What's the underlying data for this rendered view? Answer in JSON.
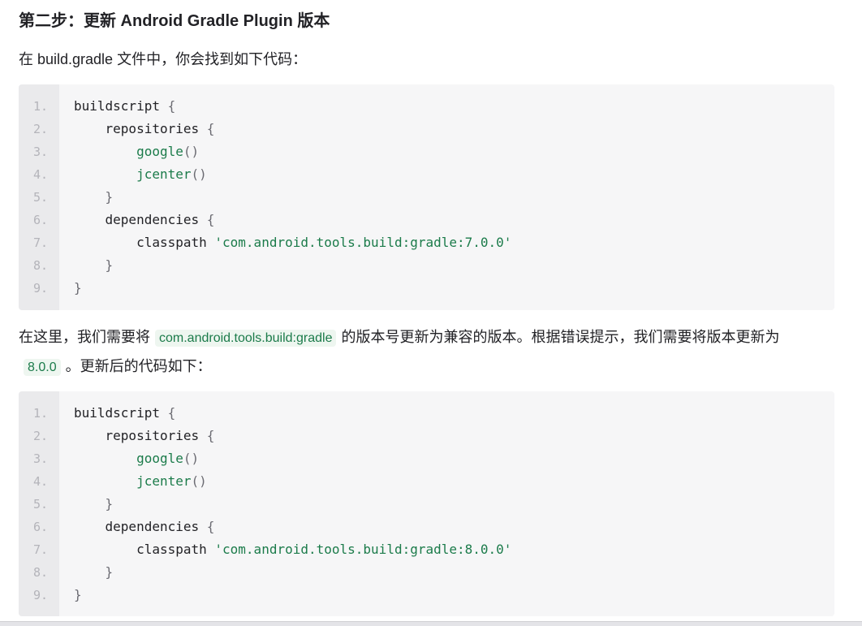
{
  "heading": "第二步：更新 Android Gradle Plugin 版本",
  "para1": "在 build.gradle 文件中，你会找到如下代码：",
  "para2": {
    "part1": "在这里，我们需要将",
    "code1": "com.android.tools.build:gradle",
    "part2": "的版本号更新为兼容的版本。根据错误提示，我们需要将版本更新为",
    "code2": "8.0.0",
    "part3": "。更新后的代码如下："
  },
  "code_blocks": [
    {
      "lines": [
        {
          "num": "1.",
          "indent": "",
          "parts": [
            {
              "t": "buildscript ",
              "c": ""
            },
            {
              "t": "{",
              "c": "pun"
            }
          ]
        },
        {
          "num": "2.",
          "indent": "    ",
          "parts": [
            {
              "t": "repositories ",
              "c": ""
            },
            {
              "t": "{",
              "c": "pun"
            }
          ]
        },
        {
          "num": "3.",
          "indent": "        ",
          "parts": [
            {
              "t": "google",
              "c": "fn"
            },
            {
              "t": "()",
              "c": "pun"
            }
          ]
        },
        {
          "num": "4.",
          "indent": "        ",
          "parts": [
            {
              "t": "jcenter",
              "c": "fn"
            },
            {
              "t": "()",
              "c": "pun"
            }
          ]
        },
        {
          "num": "5.",
          "indent": "    ",
          "parts": [
            {
              "t": "}",
              "c": "pun"
            }
          ]
        },
        {
          "num": "6.",
          "indent": "    ",
          "parts": [
            {
              "t": "dependencies ",
              "c": ""
            },
            {
              "t": "{",
              "c": "pun"
            }
          ]
        },
        {
          "num": "7.",
          "indent": "        ",
          "parts": [
            {
              "t": "classpath ",
              "c": ""
            },
            {
              "t": "'com.android.tools.build:gradle:7.0.0'",
              "c": "str"
            }
          ]
        },
        {
          "num": "8.",
          "indent": "    ",
          "parts": [
            {
              "t": "}",
              "c": "pun"
            }
          ]
        },
        {
          "num": "9.",
          "indent": "",
          "parts": [
            {
              "t": "}",
              "c": "pun"
            }
          ]
        }
      ]
    },
    {
      "lines": [
        {
          "num": "1.",
          "indent": "",
          "parts": [
            {
              "t": "buildscript ",
              "c": ""
            },
            {
              "t": "{",
              "c": "pun"
            }
          ]
        },
        {
          "num": "2.",
          "indent": "    ",
          "parts": [
            {
              "t": "repositories ",
              "c": ""
            },
            {
              "t": "{",
              "c": "pun"
            }
          ]
        },
        {
          "num": "3.",
          "indent": "        ",
          "parts": [
            {
              "t": "google",
              "c": "fn"
            },
            {
              "t": "()",
              "c": "pun"
            }
          ]
        },
        {
          "num": "4.",
          "indent": "        ",
          "parts": [
            {
              "t": "jcenter",
              "c": "fn"
            },
            {
              "t": "()",
              "c": "pun"
            }
          ]
        },
        {
          "num": "5.",
          "indent": "    ",
          "parts": [
            {
              "t": "}",
              "c": "pun"
            }
          ]
        },
        {
          "num": "6.",
          "indent": "    ",
          "parts": [
            {
              "t": "dependencies ",
              "c": ""
            },
            {
              "t": "{",
              "c": "pun"
            }
          ]
        },
        {
          "num": "7.",
          "indent": "        ",
          "parts": [
            {
              "t": "classpath ",
              "c": ""
            },
            {
              "t": "'com.android.tools.build:gradle:8.0.0'",
              "c": "str"
            }
          ]
        },
        {
          "num": "8.",
          "indent": "    ",
          "parts": [
            {
              "t": "}",
              "c": "pun"
            }
          ]
        },
        {
          "num": "9.",
          "indent": "",
          "parts": [
            {
              "t": "}",
              "c": "pun"
            }
          ]
        }
      ]
    }
  ],
  "colors": {
    "code_green": "#1b7b4a",
    "code_bg": "#f6f6f7",
    "gutter_bg": "#eaeaec",
    "inline_code_bg": "#eef6f0"
  }
}
